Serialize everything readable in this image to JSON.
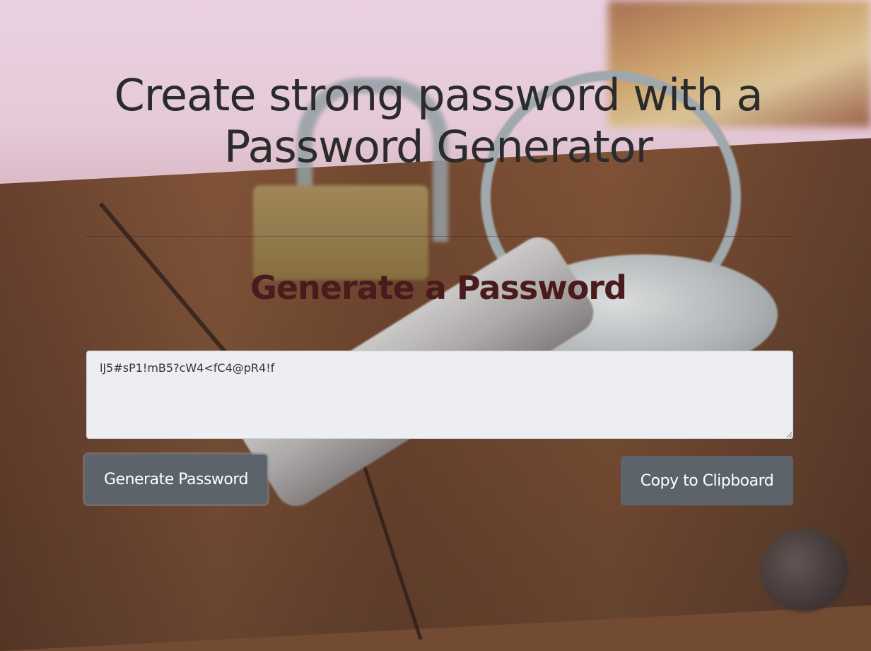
{
  "page": {
    "main_title": "Create strong password with a Password Generator",
    "sub_title": "Generate a Password"
  },
  "password_field": {
    "value": "lJ5#sP1!mB5?cW4<fC4@pR4!f"
  },
  "buttons": {
    "generate_label": "Generate Password",
    "copy_label": "Copy to Clipboard"
  },
  "colors": {
    "title_text": "#2b2b2b",
    "subtitle_text": "#4a1a1c",
    "button_bg": "#5c636a",
    "button_text": "#ffffff",
    "textarea_bg": "#eceef1"
  }
}
